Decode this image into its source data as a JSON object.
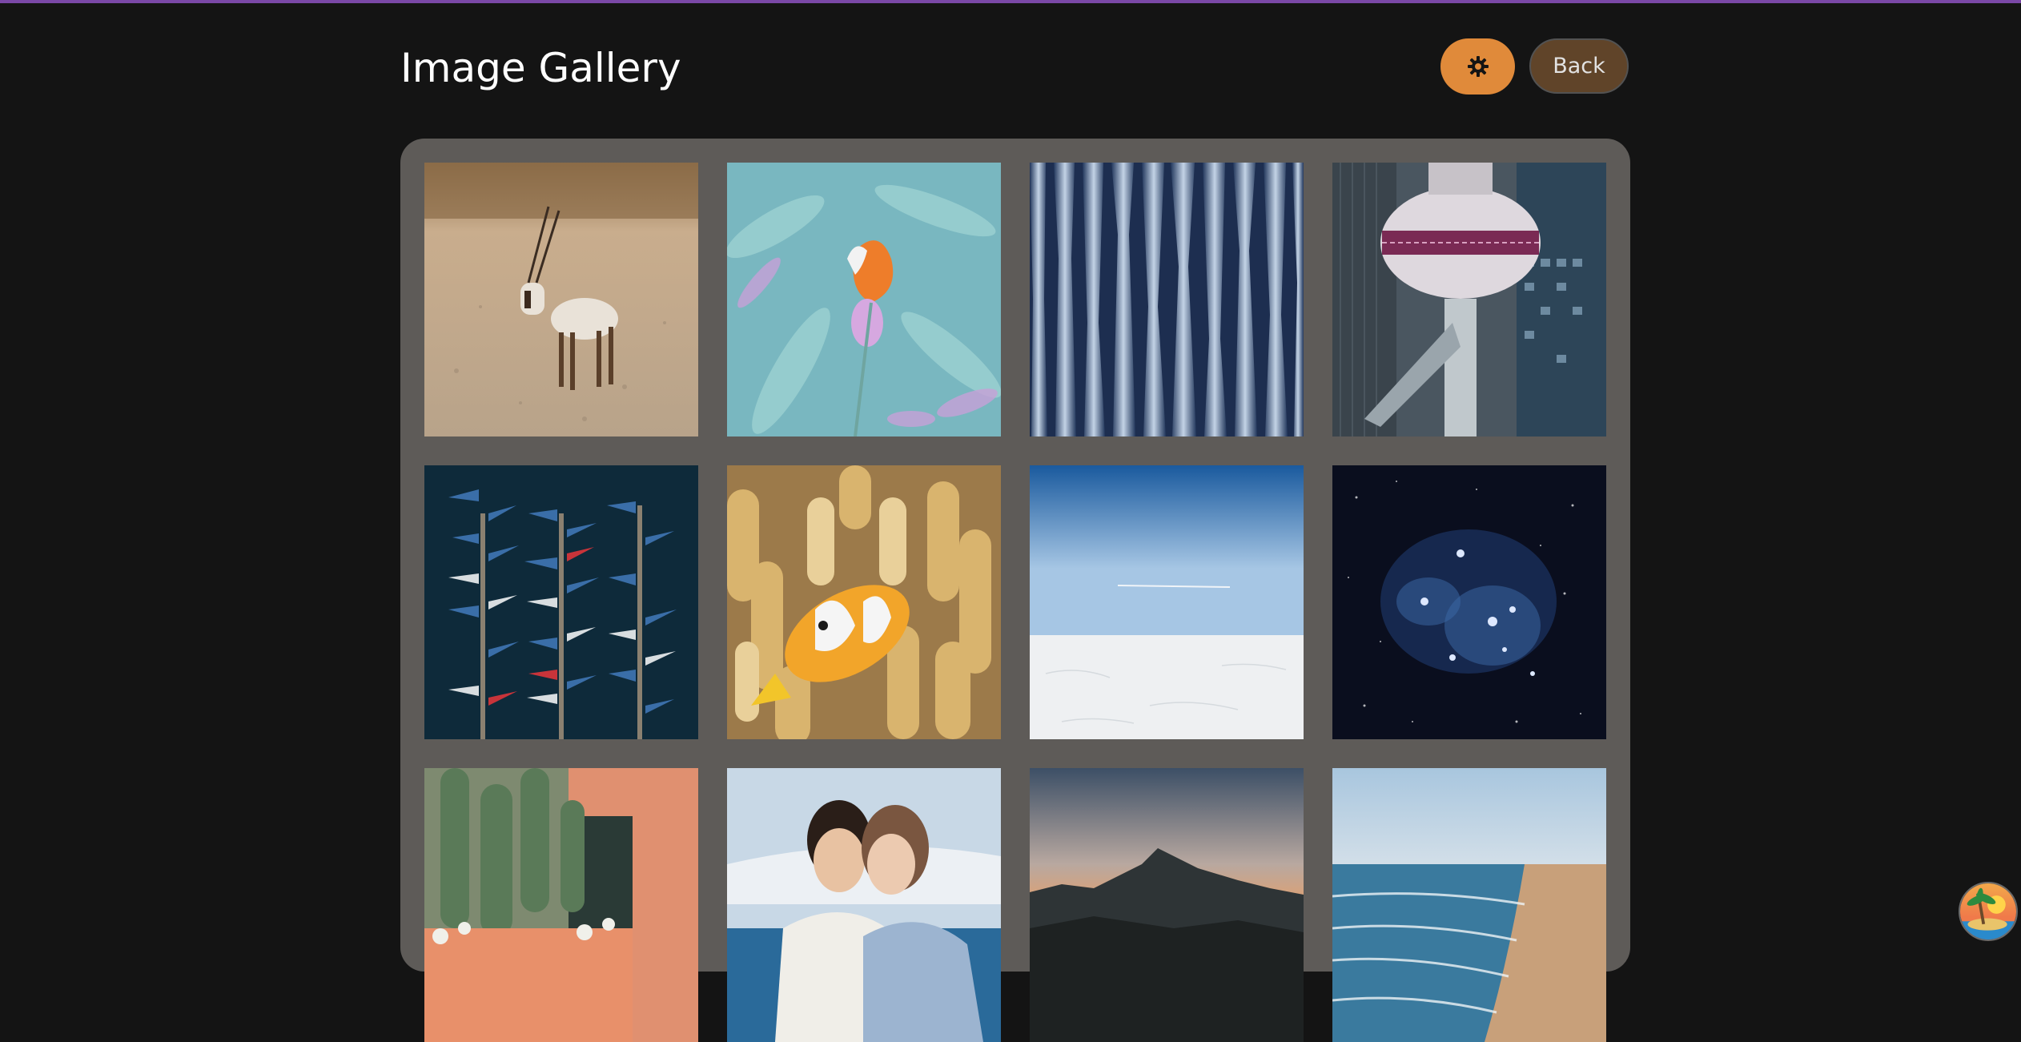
{
  "header": {
    "title": "Image Gallery",
    "theme_toggle_icon": "gear-icon",
    "back_label": "Back"
  },
  "colors": {
    "accent_bar": "#7a48a6",
    "theme_button": "#e08a3a",
    "back_button": "#6b4b2c",
    "gallery_bg": "#5e5b58",
    "page_bg": "#141414"
  },
  "gallery": {
    "images": [
      {
        "name": "oryx-desert"
      },
      {
        "name": "flower-teal"
      },
      {
        "name": "blue-glass-spikes"
      },
      {
        "name": "pearl-tower"
      },
      {
        "name": "boats-aerial"
      },
      {
        "name": "clownfish"
      },
      {
        "name": "snow-horizon"
      },
      {
        "name": "pleiades-stars"
      },
      {
        "name": "cactus-wall"
      },
      {
        "name": "couple-boat"
      },
      {
        "name": "mountain-dusk"
      },
      {
        "name": "beach-coast"
      }
    ]
  }
}
